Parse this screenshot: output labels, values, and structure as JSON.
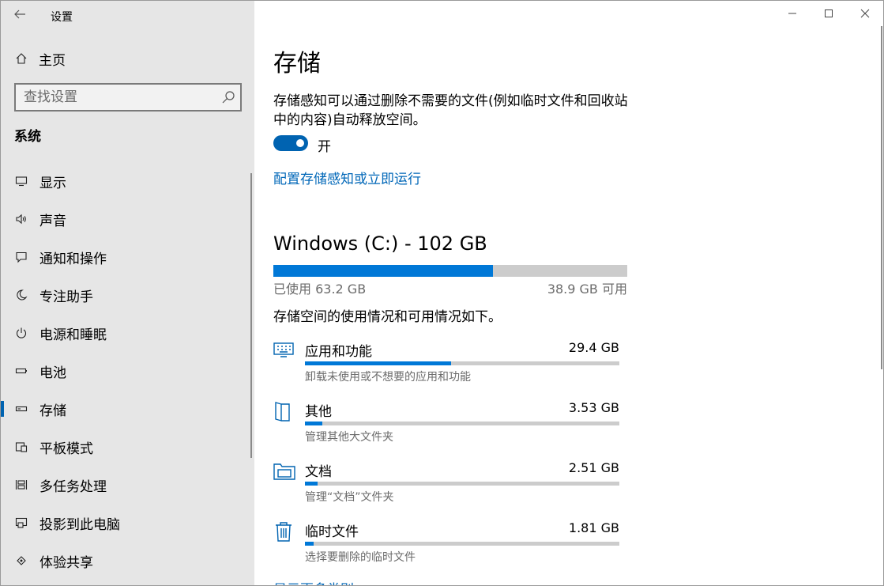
{
  "window": {
    "app_title": "设置",
    "controls": {
      "minimize": "—",
      "maximize": "☐",
      "close": "✕"
    }
  },
  "sidebar": {
    "home_label": "主页",
    "search_placeholder": "查找设置",
    "section_title": "系统",
    "items": [
      {
        "label": "显示",
        "icon": "monitor-icon"
      },
      {
        "label": "声音",
        "icon": "speaker-icon"
      },
      {
        "label": "通知和操作",
        "icon": "notification-icon"
      },
      {
        "label": "专注助手",
        "icon": "moon-icon"
      },
      {
        "label": "电源和睡眠",
        "icon": "power-icon"
      },
      {
        "label": "电池",
        "icon": "battery-icon"
      },
      {
        "label": "存储",
        "icon": "storage-icon",
        "selected": true
      },
      {
        "label": "平板模式",
        "icon": "tablet-icon"
      },
      {
        "label": "多任务处理",
        "icon": "multitask-icon"
      },
      {
        "label": "投影到此电脑",
        "icon": "projector-icon"
      },
      {
        "label": "体验共享",
        "icon": "share-icon"
      }
    ]
  },
  "main": {
    "title": "存储",
    "description": "存储感知可以通过删除不需要的文件(例如临时文件和回收站中的内容)自动释放空间。",
    "toggle_state": "开",
    "toggle_on": true,
    "configure_link": "配置存储感知或立即运行",
    "drive": {
      "title": "Windows (C:) - 102 GB",
      "used_label": "已使用 63.2 GB",
      "free_label": "38.9 GB 可用",
      "used_fraction": 0.62
    },
    "usage_desc": "存储空间的使用情况和可用情况如下。",
    "categories": [
      {
        "name": "应用和功能",
        "size": "29.4 GB",
        "sub": "卸载未使用或不想要的应用和功能",
        "fraction": 0.465,
        "icon": "apps-icon"
      },
      {
        "name": "其他",
        "size": "3.53 GB",
        "sub": "管理其他大文件夹",
        "fraction": 0.056,
        "icon": "other-icon"
      },
      {
        "name": "文档",
        "size": "2.51 GB",
        "sub": "管理“文档”文件夹",
        "fraction": 0.04,
        "icon": "documents-icon"
      },
      {
        "name": "临时文件",
        "size": "1.81 GB",
        "sub": "选择要删除的临时文件",
        "fraction": 0.028,
        "icon": "trash-icon"
      }
    ],
    "more_link": "显示更多类别"
  },
  "colors": {
    "accent": "#0078d7",
    "toggle": "#0063b1",
    "link": "#0067b8",
    "sidebar_bg": "#e6e6e6",
    "bar_bg": "#cccccc"
  }
}
